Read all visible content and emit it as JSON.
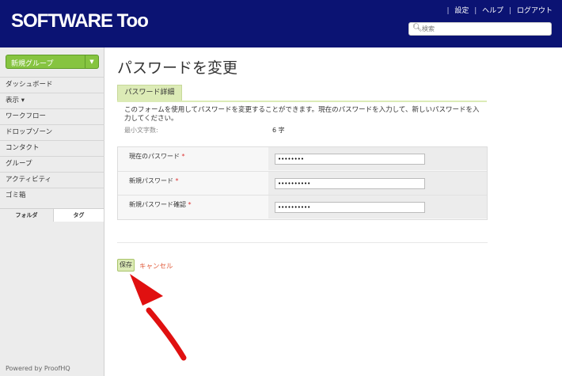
{
  "header": {
    "logo": "SOFTWARE Too",
    "links": [
      "設定",
      "ヘルプ",
      "ログアウト"
    ],
    "search_placeholder": "検索"
  },
  "sidebar": {
    "new_group_label": "新規グループ",
    "items": [
      "ダッシュボード",
      "表示 ▾",
      "ワークフロー",
      "ドロップゾーン",
      "コンタクト",
      "グループ",
      "アクティビティ",
      "ゴミ箱"
    ],
    "tabs": [
      "フォルダ",
      "タグ"
    ],
    "footer": "Powered by ProofHQ"
  },
  "main": {
    "title": "パスワードを変更",
    "section_tab": "パスワード詳細",
    "description": "このフォームを使用してパスワードを変更することができます。現在のパスワードを入力して、新しいパスワードを入力してください。",
    "min_length_label": "最小文字数:",
    "min_length_value": "6 字",
    "fields": [
      {
        "label": "現在のパスワード",
        "value": "••••••••"
      },
      {
        "label": "新規パスワード",
        "value": "••••••••••"
      },
      {
        "label": "新規パスワード確認",
        "value": "••••••••••"
      }
    ],
    "save_label": "保存",
    "cancel_label": "キャンセル"
  },
  "colors": {
    "header_bg": "#0b1373",
    "accent_green": "#86c440",
    "tab_green": "#dcebb6",
    "cancel_red": "#e05a3a",
    "arrow_red": "#e01010"
  }
}
